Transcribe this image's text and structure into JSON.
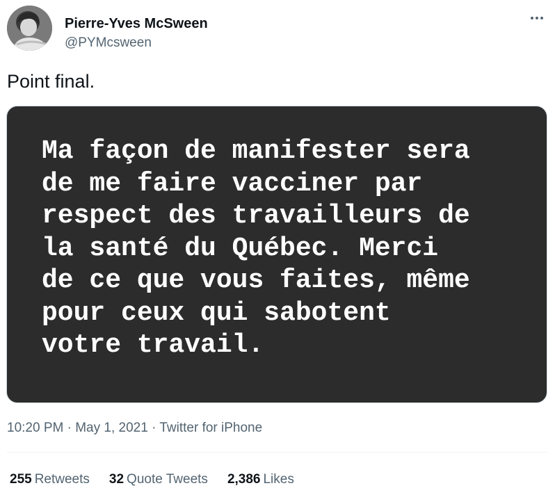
{
  "author": {
    "name": "Pierre-Yves McSween",
    "handle": "@PYMcsween"
  },
  "tweet": {
    "text": "Point final.",
    "image_text": "Ma façon de manifester sera\nde me faire vacciner par\nrespect des travailleurs de\nla santé du Québec. Merci\nde ce que vous faites, même\npour ceux qui sabotent\nvotre travail."
  },
  "meta": {
    "time": "10:20 PM",
    "separator": " · ",
    "date": "May 1, 2021",
    "source": "Twitter for iPhone"
  },
  "stats": {
    "retweets_count": "255",
    "retweets_label": "Retweets",
    "quotes_count": "32",
    "quotes_label": "Quote Tweets",
    "likes_count": "2,386",
    "likes_label": "Likes"
  },
  "icons": {
    "more": "more-horizontal-icon"
  },
  "colors": {
    "text": "#0f1419",
    "secondary": "#536471",
    "media_bg": "#2c2c2c"
  }
}
